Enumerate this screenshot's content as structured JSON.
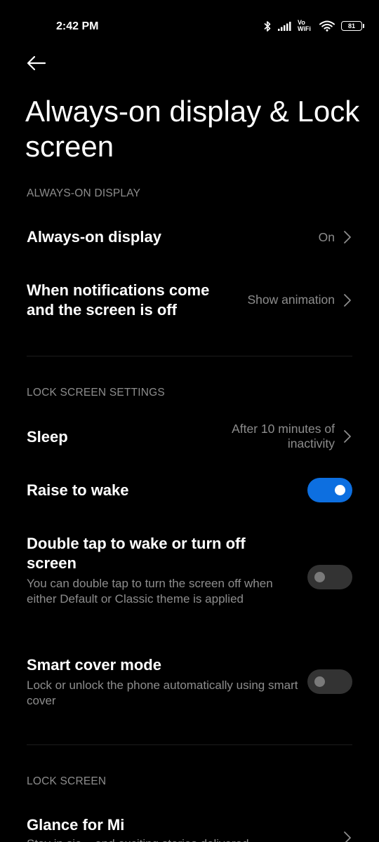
{
  "status_bar": {
    "time": "2:42 PM",
    "network_label_top": "Vo",
    "network_label_bottom": "WiFi",
    "battery_level": "81",
    "icons": [
      "bluetooth-icon",
      "signal-icon",
      "vowifi-icon",
      "wifi-icon",
      "battery-icon"
    ]
  },
  "header": {
    "back_icon": "arrow-left-icon",
    "title": "Always-on display & Lock screen"
  },
  "sections": {
    "aod": {
      "header": "ALWAYS-ON DISPLAY",
      "always_on": {
        "title": "Always-on display",
        "value": "On"
      },
      "notifications": {
        "title_line1": "When notifications come",
        "title_line2": "and the screen is off",
        "value": "Show animation"
      }
    },
    "lock_settings": {
      "header": "LOCK SCREEN SETTINGS",
      "sleep": {
        "title": "Sleep",
        "value_line1": "After 10 minutes of",
        "value_line2": "inactivity"
      },
      "raise_to_wake": {
        "title": "Raise to wake",
        "enabled": true
      },
      "double_tap": {
        "title_line1": "Double tap to wake or turn off",
        "title_line2": "screen",
        "subtitle": "You can double tap to turn the screen off when either Default or Classic theme is applied",
        "enabled": false
      },
      "smart_cover": {
        "title": "Smart cover mode",
        "subtitle": "Lock or unlock the phone automatically using smart cover",
        "enabled": false
      }
    },
    "lock_screen": {
      "header": "LOCK SCREEN",
      "glance": {
        "title": "Glance for Mi",
        "subtitle_partial": "Stay in sie... and exciting stories delivered..."
      }
    }
  },
  "colors": {
    "background": "#000000",
    "accent": "#0d6fe0",
    "secondary_text": "#8d8d8d"
  }
}
